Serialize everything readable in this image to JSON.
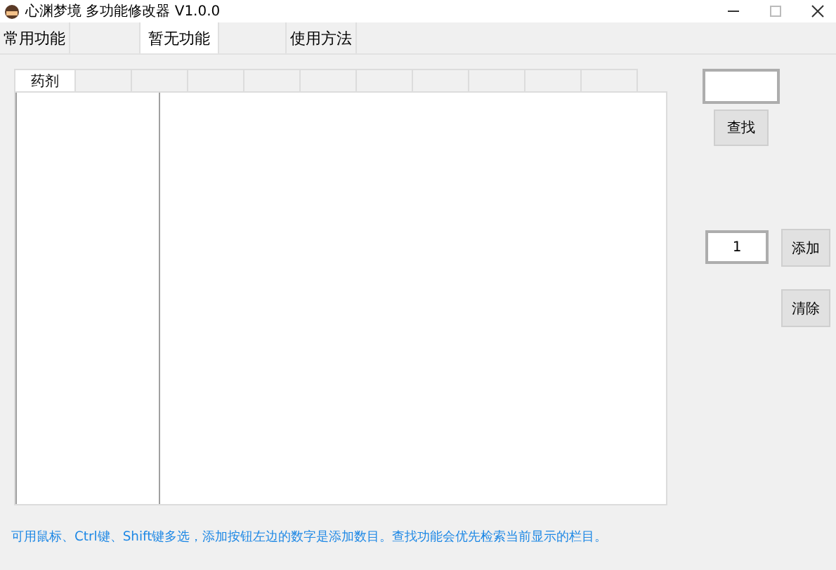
{
  "window": {
    "title": "心渊梦境 多功能修改器  V1.0.0"
  },
  "tabs": [
    {
      "label": "常用功能",
      "selected": false
    },
    {
      "selected": false
    },
    {
      "label": "暂无功能",
      "selected": true
    },
    {
      "selected": false
    },
    {
      "label": "使用方法",
      "selected": false
    }
  ],
  "inner_tabs": [
    {
      "label": "药剂",
      "selected": true
    },
    {
      "selected": false
    },
    {
      "selected": false
    },
    {
      "selected": false
    },
    {
      "selected": false
    },
    {
      "selected": false
    },
    {
      "selected": false
    },
    {
      "selected": false
    },
    {
      "selected": false
    },
    {
      "selected": false
    },
    {
      "selected": false
    }
  ],
  "search_button": "查找",
  "count_field": {
    "value": "1"
  },
  "add_button": "添加",
  "clear_button": "清除",
  "hint": "可用鼠标、Ctrl键、Shift键多选，添加按钮左边的数字是添加数目。查找功能会优先检索当前显示的栏目。"
}
